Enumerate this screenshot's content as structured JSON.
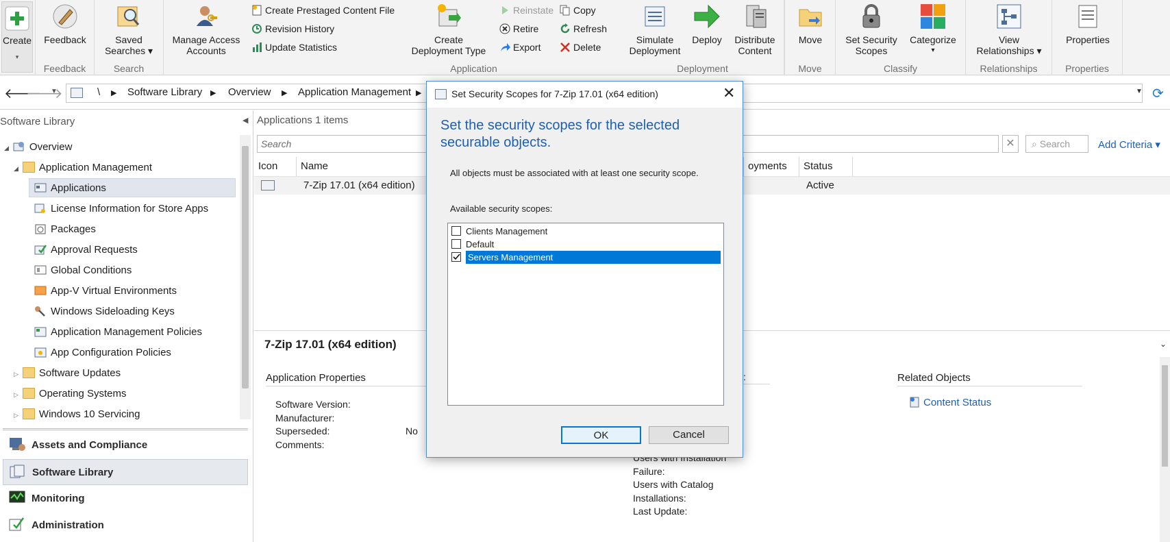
{
  "ribbon": {
    "create": {
      "label": "Create"
    },
    "feedback": {
      "label": "Feedback",
      "group": "Feedback"
    },
    "saved_searches": {
      "label": "Saved",
      "label2": "Searches ▾",
      "group": "Search"
    },
    "manage_access": {
      "label": "Manage Access",
      "label2": "Accounts"
    },
    "create_prestaged": "Create Prestaged Content File",
    "revision_history": "Revision History",
    "update_statistics": "Update Statistics",
    "create_deployment_type": {
      "label": "Create",
      "label2": "Deployment Type"
    },
    "reinstate": "Reinstate",
    "retire": "Retire",
    "export": "Export",
    "copy": "Copy",
    "refresh": "Refresh",
    "delete": "Delete",
    "application_group": "Application",
    "simulate": {
      "label": "Simulate",
      "label2": "Deployment"
    },
    "deploy": {
      "label": "Deploy"
    },
    "distribute": {
      "label": "Distribute",
      "label2": "Content"
    },
    "deployment_group": "Deployment",
    "move": {
      "label": "Move",
      "group": "Move"
    },
    "set_security": {
      "label": "Set Security",
      "label2": "Scopes"
    },
    "categorize": {
      "label": "Categorize",
      "label2": "▾"
    },
    "classify_group": "Classify",
    "view_relationships": {
      "label": "View",
      "label2": "Relationships ▾",
      "group": "Relationships"
    },
    "properties": {
      "label": "Properties",
      "group": "Properties"
    }
  },
  "breadcrumb": [
    "\\",
    "Software Library",
    "Overview",
    "Application Management"
  ],
  "nav": {
    "title": "Software Library",
    "tree": [
      "Overview",
      "Application Management",
      "Applications",
      "License Information for Store Apps",
      "Packages",
      "Approval Requests",
      "Global Conditions",
      "App-V Virtual Environments",
      "Windows Sideloading Keys",
      "Application Management Policies",
      "App Configuration Policies",
      "Software Updates",
      "Operating Systems",
      "Windows 10 Servicing"
    ],
    "workspaces": [
      "Assets and Compliance",
      "Software Library",
      "Monitoring",
      "Administration"
    ]
  },
  "main": {
    "header_title": "Applications",
    "header_count": "1 items",
    "search_placeholder": "Search",
    "search_button": "Search",
    "add_criteria": "Add Criteria ▾",
    "columns": [
      "Icon",
      "Name",
      "oyments",
      "Status"
    ],
    "rows": [
      {
        "name": "7-Zip 17.01 (x64 edition)",
        "status": "Active"
      }
    ],
    "detail_title": "7-Zip 17.01 (x64 edition)",
    "app_props_title": "Application Properties",
    "props": [
      {
        "label": "Software Version:",
        "value": ""
      },
      {
        "label": "Manufacturer:",
        "value": ""
      },
      {
        "label": "Superseded:",
        "value": "No"
      },
      {
        "label": "Comments:",
        "value": ""
      }
    ],
    "stats": [
      "Users with Installation",
      "Failure:",
      "Users with Catalog",
      "Installations:",
      "Last Update:"
    ],
    "related_title": "Related Objects",
    "content_status": "Content Status"
  },
  "dialog": {
    "title": "Set Security Scopes for 7-Zip 17.01 (x64 edition)",
    "heading": "Set the security scopes for the selected securable objects.",
    "note": "All objects must be associated with at least one security scope.",
    "available_label": "Available security scopes:",
    "scopes": [
      {
        "name": "Clients Management",
        "checked": false
      },
      {
        "name": "Default",
        "checked": false
      },
      {
        "name": "Servers Management",
        "checked": true
      }
    ],
    "ok": "OK",
    "cancel": "Cancel"
  },
  "colors": {
    "accent": "#0078d7",
    "heading_blue": "#1e5fb4",
    "selection": "#0078d7"
  }
}
